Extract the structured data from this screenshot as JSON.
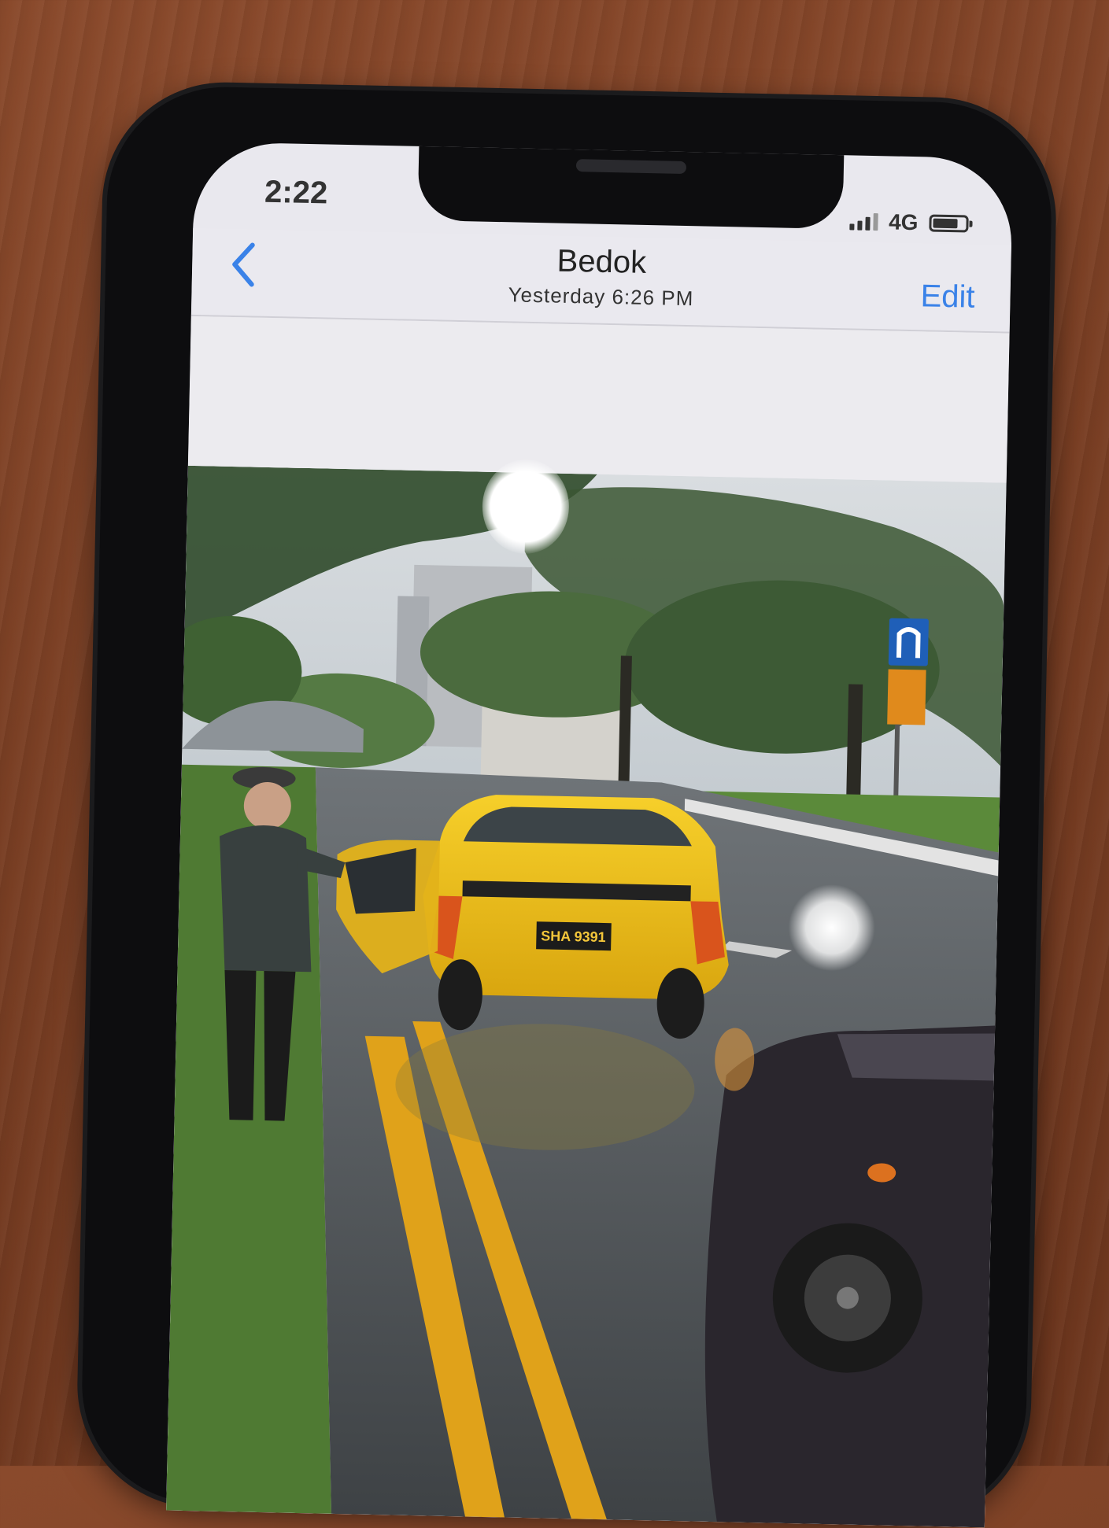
{
  "status_bar": {
    "time": "2:22",
    "network": "4G"
  },
  "nav": {
    "title": "Bedok",
    "subtitle": "Yesterday  6:26 PM",
    "edit_label": "Edit"
  },
  "photo": {
    "plate_text": "SHA 9391"
  },
  "colors": {
    "accent": "#3a82e8",
    "taxi": "#f1c21b"
  },
  "icons": {
    "back": "chevron-left-icon",
    "signal": "signal-bars-icon",
    "battery": "battery-icon"
  }
}
